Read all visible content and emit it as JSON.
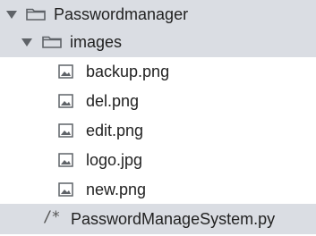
{
  "tree": {
    "root": {
      "label": "Passwordmanager",
      "icon": "folder-icon",
      "expanded": true
    },
    "folder": {
      "label": "images",
      "icon": "folder-icon",
      "expanded": true
    },
    "files": [
      {
        "label": "backup.png",
        "icon": "image-file-icon"
      },
      {
        "label": "del.png",
        "icon": "image-file-icon"
      },
      {
        "label": "edit.png",
        "icon": "image-file-icon"
      },
      {
        "label": "logo.jpg",
        "icon": "image-file-icon"
      },
      {
        "label": "new.png",
        "icon": "image-file-icon"
      }
    ],
    "script": {
      "label": "PasswordManageSystem.py",
      "icon_text": "/*",
      "icon": "code-file-icon"
    }
  },
  "colors": {
    "selected_row": "#dadde3",
    "text": "#222222",
    "icon": "#5f6368"
  }
}
